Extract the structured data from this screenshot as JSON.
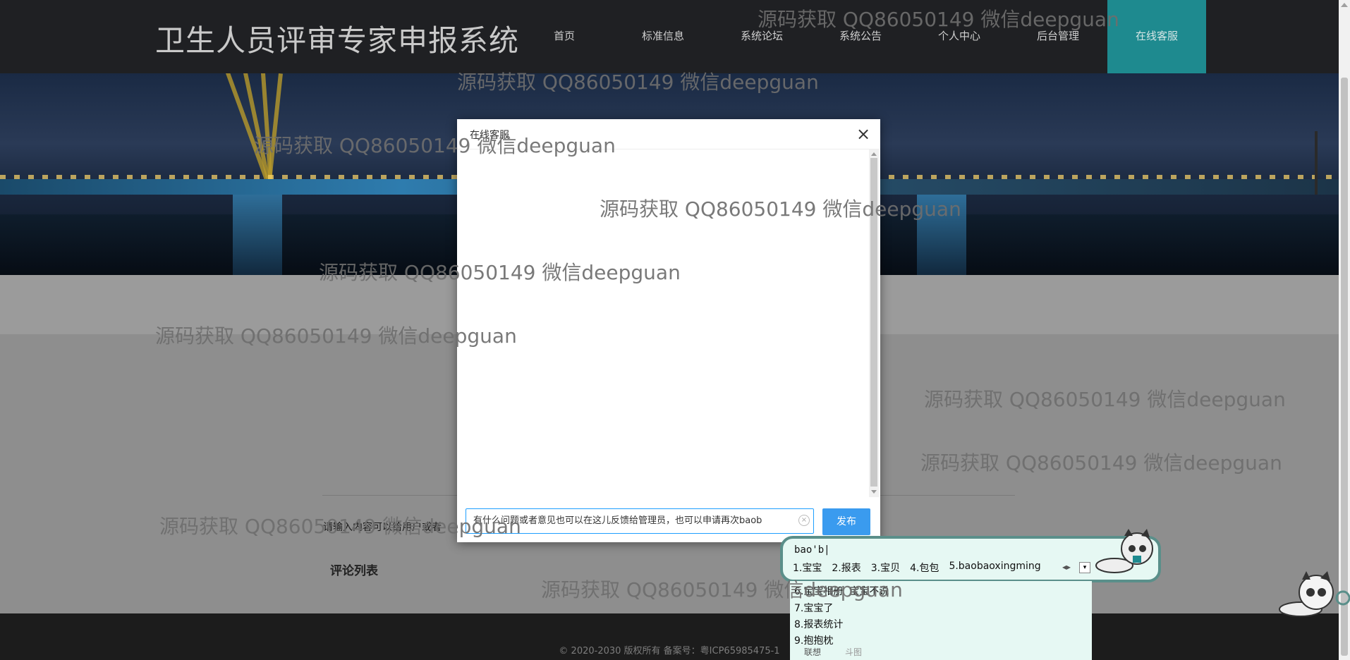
{
  "site": {
    "title": "卫生人员评审专家申报系统"
  },
  "nav": {
    "items": [
      {
        "label": "首页"
      },
      {
        "label": "标准信息"
      },
      {
        "label": "系统论坛"
      },
      {
        "label": "系统公告"
      },
      {
        "label": "个人中心"
      },
      {
        "label": "后台管理"
      },
      {
        "label": "在线客服"
      }
    ]
  },
  "page": {
    "comment_hint": "请输入内容可以给用户或者",
    "comment_list_title": "评论列表",
    "copyright": "© 2020-2030 版权所有 备案号：粤ICP65985475-1"
  },
  "modal": {
    "title": "在线客服",
    "close_label": "×",
    "input_value": "有什么问题或者意见也可以在这儿反馈给管理员，也可以申请再次baob",
    "clear_label": "×",
    "publish_label": "发布"
  },
  "ime": {
    "pinyin": "bao'b|",
    "candidates": [
      "1.宝宝",
      "2.报表",
      "3.宝贝",
      "4.包包",
      "5.baobaoxingming"
    ],
    "extra": [
      "6.宝宝相册",
      "宝宝不说",
      "7.宝宝了",
      "8.报表统计",
      "9.抱抱枕"
    ],
    "tabs": [
      "联想",
      "斗图"
    ]
  },
  "watermark": {
    "text": "源码获取 QQ86050149 微信deepguan"
  },
  "colors": {
    "nav_bg": "#1f2023",
    "active_nav": "#1e8a8f",
    "publish": "#3a9bef",
    "input_border": "#1e9fff",
    "ime_bg": "#e6f8f3"
  }
}
